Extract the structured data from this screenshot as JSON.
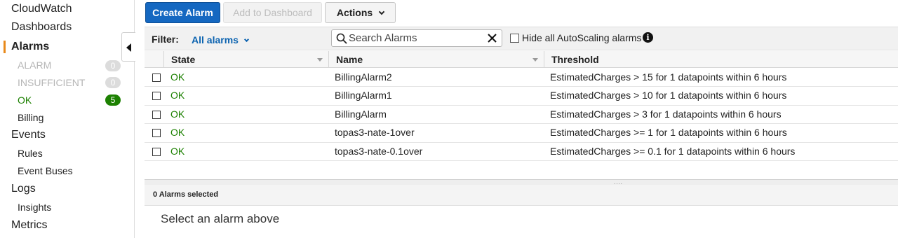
{
  "sidebar": {
    "service": "CloudWatch",
    "dashboards": "Dashboards",
    "alarms": "Alarms",
    "alarm_states": [
      {
        "label": "ALARM",
        "count": "0"
      },
      {
        "label": "INSUFFICIENT",
        "count": "0"
      },
      {
        "label": "OK",
        "count": "5"
      }
    ],
    "billing": "Billing",
    "events": "Events",
    "rules": "Rules",
    "event_buses": "Event Buses",
    "logs": "Logs",
    "insights": "Insights",
    "metrics": "Metrics",
    "accent_color": "#e8891a",
    "ok_badge_color": "#1d8102"
  },
  "toolbar": {
    "create_label": "Create Alarm",
    "add_dashboard_label": "Add to Dashboard",
    "actions_label": "Actions",
    "primary_color": "#1568c1"
  },
  "filter": {
    "label": "Filter:",
    "selected": "All alarms",
    "search_placeholder": "Search Alarms",
    "hide_autoscaling_label": "Hide all AutoScaling alarms",
    "hide_autoscaling_checked": false
  },
  "table": {
    "columns": [
      "State",
      "Name",
      "Threshold"
    ],
    "rows": [
      {
        "state": "OK",
        "name": "BillingAlarm2",
        "threshold": "EstimatedCharges > 15 for 1 datapoints within 6 hours"
      },
      {
        "state": "OK",
        "name": "BillingAlarm1",
        "threshold": "EstimatedCharges > 10 for 1 datapoints within 6 hours"
      },
      {
        "state": "OK",
        "name": "BillingAlarm",
        "threshold": "EstimatedCharges > 3 for 1 datapoints within 6 hours"
      },
      {
        "state": "OK",
        "name": "topas3-nate-1over",
        "threshold": "EstimatedCharges >= 1 for 1 datapoints within 6 hours"
      },
      {
        "state": "OK",
        "name": "topas3-nate-0.1over",
        "threshold": "EstimatedCharges >= 0.1 for 1 datapoints within 6 hours"
      }
    ],
    "ok_color": "#1d8102"
  },
  "details": {
    "selected_count": "0 Alarms selected",
    "empty_message": "Select an alarm above"
  }
}
